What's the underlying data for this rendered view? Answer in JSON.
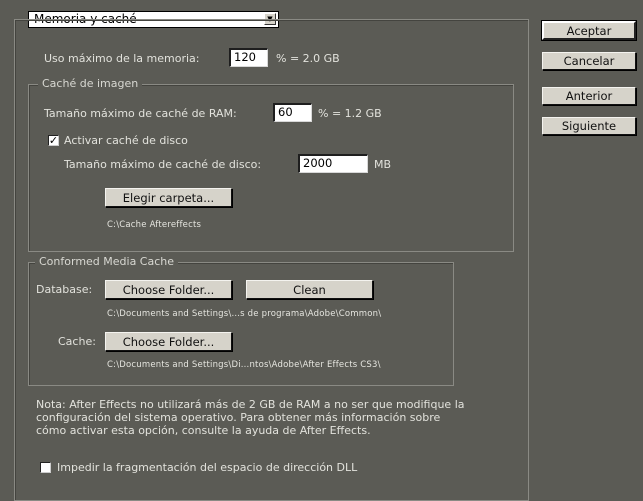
{
  "section_select": {
    "value": "Memoria y caché",
    "arrow_icon": "triangle-down"
  },
  "buttons": {
    "ok": "Aceptar",
    "cancel": "Cancelar",
    "previous": "Anterior",
    "next": "Siguiente"
  },
  "memory": {
    "label": "Uso máximo de la memoria:",
    "value": "120",
    "suffix": "% = 2.0 GB"
  },
  "image_cache": {
    "legend": "Caché de imagen",
    "ram_label": "Tamaño máximo de caché de RAM:",
    "ram_value": "60",
    "ram_suffix": "% = 1.2 GB",
    "disk_cache_checkbox": "Activar caché de disco",
    "disk_cache_checked": true,
    "disk_size_label": "Tamaño máximo de caché de disco:",
    "disk_size_value": "2000",
    "disk_size_unit": "MB",
    "choose_folder_button": "Elegir carpeta...",
    "folder_path": "C:\\Cache Aftereffects"
  },
  "conformed_media_cache": {
    "legend": "Conformed Media Cache",
    "database_label": "Database:",
    "database_choose_button": "Choose Folder...",
    "clean_button": "Clean",
    "database_path": "C:\\Documents and Settings\\...s de programa\\Adobe\\Common\\",
    "cache_label": "Cache:",
    "cache_choose_button": "Choose Folder...",
    "cache_path": "C:\\Documents and Settings\\Di...ntos\\Adobe\\After Effects CS3\\"
  },
  "note": {
    "line1": "Nota: After Effects no utilizará más de 2 GB de RAM a no ser que modifique la",
    "line2": "configuración del sistema operativo. Para obtener más información sobre",
    "line3": "cómo activar esta opción, consulte la ayuda de After Effects."
  },
  "dll_checkbox": {
    "label": "Impedir la fragmentación del espacio de dirección DLL",
    "checked": false
  }
}
